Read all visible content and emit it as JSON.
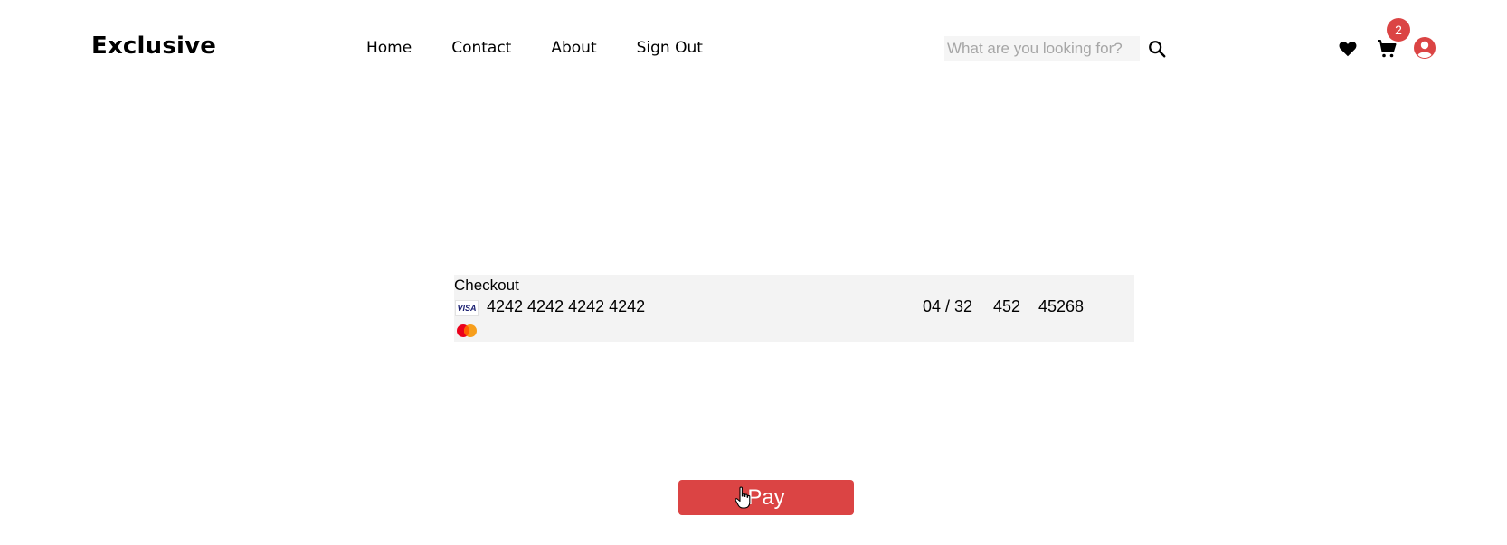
{
  "header": {
    "logo": "Exclusive",
    "nav": [
      "Home",
      "Contact",
      "About",
      "Sign Out"
    ],
    "search": {
      "placeholder": "What are you looking for?",
      "value": ""
    },
    "cart_count": "2",
    "icons": [
      "search-icon",
      "heart-icon",
      "cart-icon",
      "user-icon"
    ]
  },
  "checkout": {
    "title": "Checkout",
    "card_brand_visa": "VISA",
    "card_number": "4242 4242 4242 4242",
    "expiry": "04 / 32",
    "cvc": "452",
    "zip": "45268",
    "pay_label": "Pay"
  },
  "colors": {
    "accent": "#db4444",
    "panel_bg": "#f3f3f3",
    "search_bg": "#f5f5f5"
  }
}
